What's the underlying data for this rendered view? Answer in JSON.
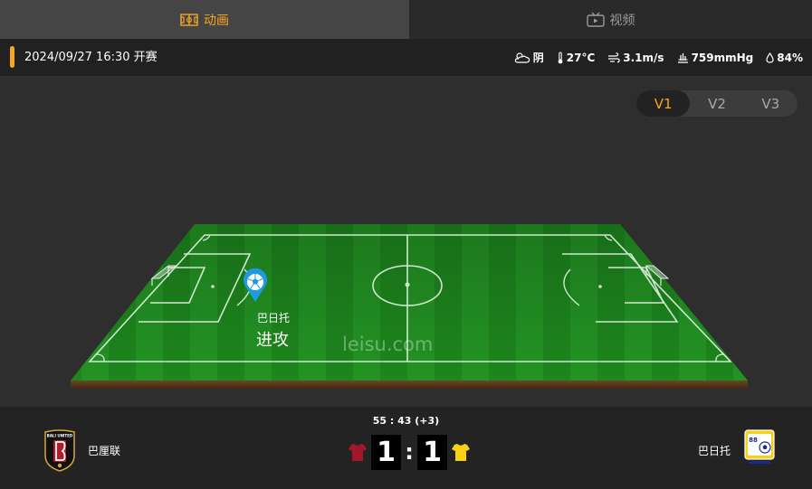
{
  "tabs": [
    {
      "label": "动画",
      "icon": "pitch-icon",
      "active": true
    },
    {
      "label": "视频",
      "icon": "tv-icon",
      "active": false
    }
  ],
  "match_info": {
    "kickoff": "2024/09/27 16:30 开赛",
    "weather": {
      "sky": "阴",
      "temperature": "27°C",
      "wind": "3.1m/s",
      "pressure": "759mmHg",
      "humidity": "84%"
    }
  },
  "view_switch": {
    "options": [
      "V1",
      "V2",
      "V3"
    ],
    "selected": "V1"
  },
  "pitch": {
    "event_team": "巴日托",
    "event_action": "进攻",
    "watermark": "leisu.com",
    "marker_icon": "football-marker-icon"
  },
  "scoreboard": {
    "clock": "55 : 43  (+3)",
    "home": {
      "name": "巴厘联",
      "score": "1",
      "logo_text": "BALI UNITED",
      "shirt_color": "#a4162a"
    },
    "away": {
      "name": "巴日托",
      "score": "1",
      "logo_text": "88",
      "shirt_color": "#f5d218"
    },
    "separator": ":"
  },
  "colors": {
    "accent": "#f5a623",
    "pitch_green": "#1f8a1f",
    "soil": "#5a3a1c"
  }
}
